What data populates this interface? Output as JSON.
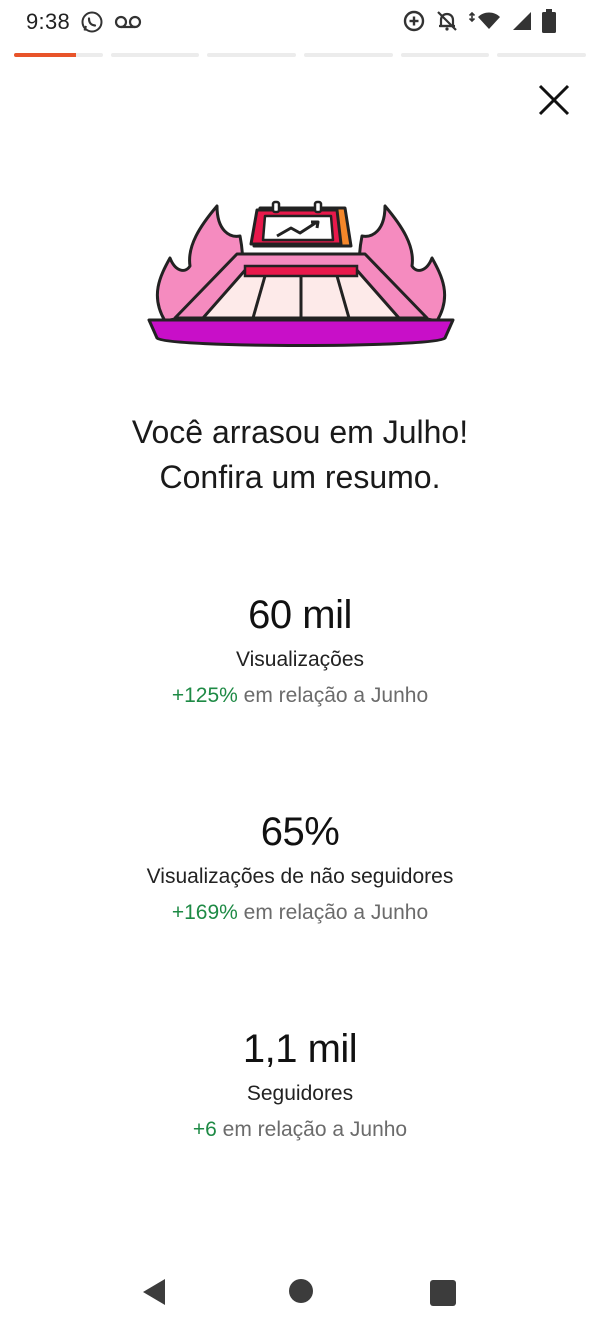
{
  "status_bar": {
    "time": "9:38",
    "left_icons": [
      "whatsapp-icon",
      "voicemail-icon"
    ],
    "right_icons": [
      "data-saver-icon",
      "notifications-off-icon",
      "wifi-icon",
      "signal-icon",
      "battery-icon"
    ]
  },
  "stories_progress": {
    "segments": 6,
    "active_index": 0,
    "active_fill": 0.7,
    "accent_color": "#e8542a"
  },
  "close_icon": "close-icon",
  "hero_icon": "trending-calendar-illustration",
  "headline": {
    "line1": "Você arrasou em Julho!",
    "line2": "Confira um resumo."
  },
  "stats": [
    {
      "value": "60 mil",
      "label": "Visualizações",
      "delta": "+125%",
      "comparison": " em relação a Junho"
    },
    {
      "value": "65%",
      "label": "Visualizações de não seguidores",
      "delta": "+169%",
      "comparison": " em relação a Junho"
    },
    {
      "value": "1,1 mil",
      "label": "Seguidores",
      "delta": "+6",
      "comparison": " em relação a Junho"
    }
  ],
  "colors": {
    "positive": "#1e8a45",
    "muted": "#6b6b6b",
    "accent": "#e8542a"
  },
  "nav_bar": {
    "icons": [
      "back-icon",
      "home-icon",
      "recents-icon"
    ]
  }
}
